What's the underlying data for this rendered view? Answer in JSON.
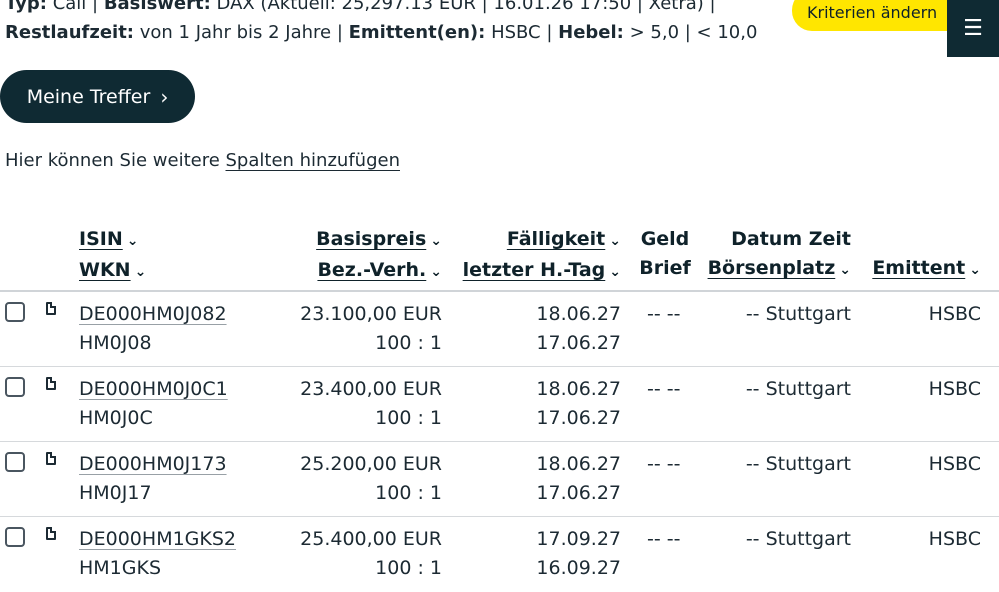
{
  "criteria": {
    "line1": [
      {
        "label": "Typ:",
        "value": " Call | "
      },
      {
        "label": "Basiswert:",
        "value": " DAX (Aktuell: 25,297.13 EUR | 16.01.26 17:50 | Xetra) |"
      }
    ],
    "line2": [
      {
        "label": "Restlaufzeit:",
        "value": " von 1 Jahr bis 2 Jahre | "
      },
      {
        "label": "Emittent(en):",
        "value": " HSBC | "
      },
      {
        "label": "Hebel:",
        "value": " > 5,0 | < 10,0"
      }
    ]
  },
  "buttons": {
    "change_criteria": "Kriterien ändern",
    "menu_icon": "☰",
    "my_hits": "Meine Treffer",
    "my_hits_icon": "›"
  },
  "hint": {
    "prefix": "Hier können Sie weitere ",
    "link": "Spalten hinzufügen"
  },
  "columns": {
    "isin": "ISIN",
    "wkn": "WKN",
    "strike": "Basispreis",
    "ratio": "Bez.-Verh.",
    "maturity": "Fälligkeit",
    "last_trade": "letzter H.-Tag",
    "bid": "Geld",
    "ask": "Brief",
    "datetime": "Datum Zeit",
    "exchange": "Börsenplatz",
    "issuer": "Emittent",
    "sort_icon": "⌄"
  },
  "rows": [
    {
      "isin": "DE000HM0J082",
      "wkn": "HM0J08",
      "strike": "23.100,00 EUR",
      "ratio": "100 : 1",
      "maturity": "18.06.27",
      "last_trade": "17.06.27",
      "bid_ask": "-- --",
      "datetime_exchange": "-- Stuttgart",
      "issuer": "HSBC"
    },
    {
      "isin": "DE000HM0J0C1",
      "wkn": "HM0J0C",
      "strike": "23.400,00 EUR",
      "ratio": "100 : 1",
      "maturity": "18.06.27",
      "last_trade": "17.06.27",
      "bid_ask": "-- --",
      "datetime_exchange": "-- Stuttgart",
      "issuer": "HSBC"
    },
    {
      "isin": "DE000HM0J173",
      "wkn": "HM0J17",
      "strike": "25.200,00 EUR",
      "ratio": "100 : 1",
      "maturity": "18.06.27",
      "last_trade": "17.06.27",
      "bid_ask": "-- --",
      "datetime_exchange": "-- Stuttgart",
      "issuer": "HSBC"
    },
    {
      "isin": "DE000HM1GKS2",
      "wkn": "HM1GKS",
      "strike": "25.400,00 EUR",
      "ratio": "100 : 1",
      "maturity": "17.09.27",
      "last_trade": "16.09.27",
      "bid_ask": "-- --",
      "datetime_exchange": "-- Stuttgart",
      "issuer": "HSBC"
    }
  ]
}
